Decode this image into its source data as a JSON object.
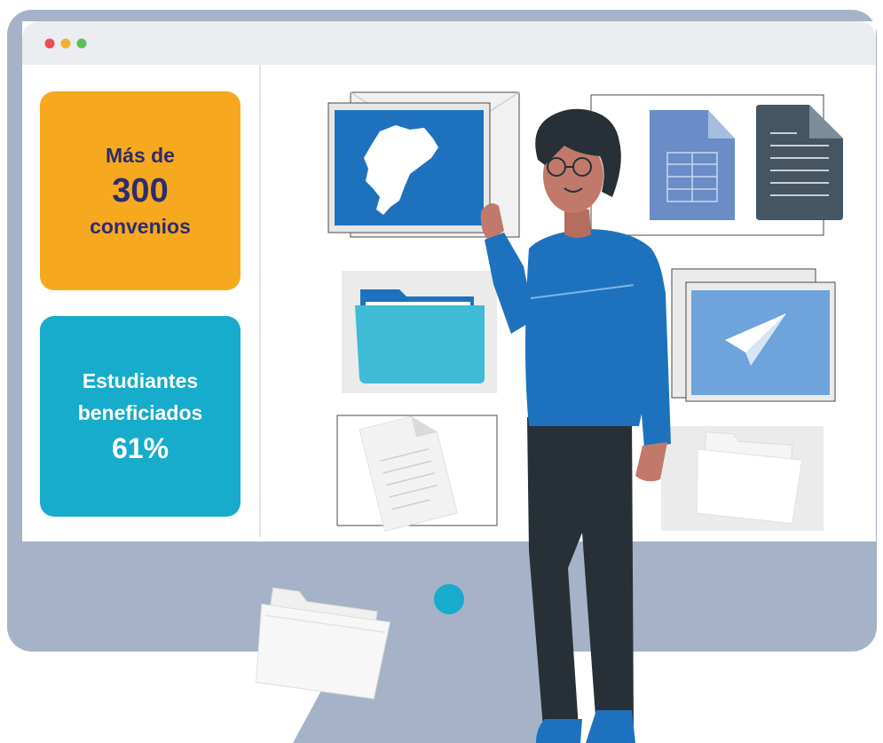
{
  "window": {
    "controls": [
      "close-dot",
      "minimize-dot",
      "maximize-dot"
    ],
    "colors": {
      "close": "#ef4a55",
      "minimize": "#f6b12b",
      "maximize": "#5bc157"
    }
  },
  "stats": {
    "convenios": {
      "line1": "Más de",
      "line2": "300",
      "line3": "convenios",
      "background": "#f6a81e",
      "text_color": "#2d2c70"
    },
    "estudiantes": {
      "line1": "Estudiantes",
      "line2": "beneficiados",
      "line3": "61%",
      "background": "#17abcc",
      "text_color": "#ffffff"
    }
  },
  "icons": [
    "ecuador-map-icon",
    "spreadsheet-icon",
    "document-icon",
    "folder-icon",
    "paper-plane-icon",
    "sheet-icon",
    "folder-outline-icon"
  ],
  "colors": {
    "monitor_frame": "#a5b2c7",
    "screen_bar": "#ebedf1",
    "accent_blue": "#1e72bd",
    "folder_cyan": "#3fbbd6"
  }
}
